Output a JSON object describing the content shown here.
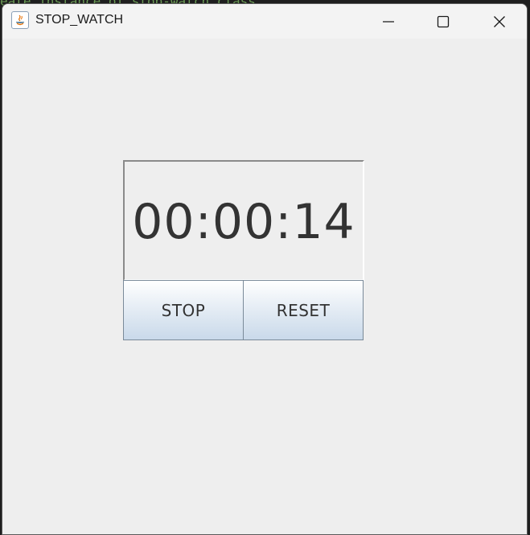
{
  "background_code": "eate instance of stop-watch class",
  "window": {
    "title": "STOP_WATCH",
    "app_icon": "java-icon",
    "controls": {
      "minimize": "minimize-icon",
      "maximize": "maximize-icon",
      "close": "close-icon"
    }
  },
  "stopwatch": {
    "time": "00:00:14",
    "stop_label": "STOP",
    "reset_label": "RESET"
  },
  "colors": {
    "window_bg": "#eeeeee",
    "titlebar_bg": "#f3f3f3",
    "text": "#333333",
    "button_gradient_top": "#ffffff",
    "button_gradient_bottom": "#c9d9ea",
    "button_border": "#7a8a99"
  }
}
